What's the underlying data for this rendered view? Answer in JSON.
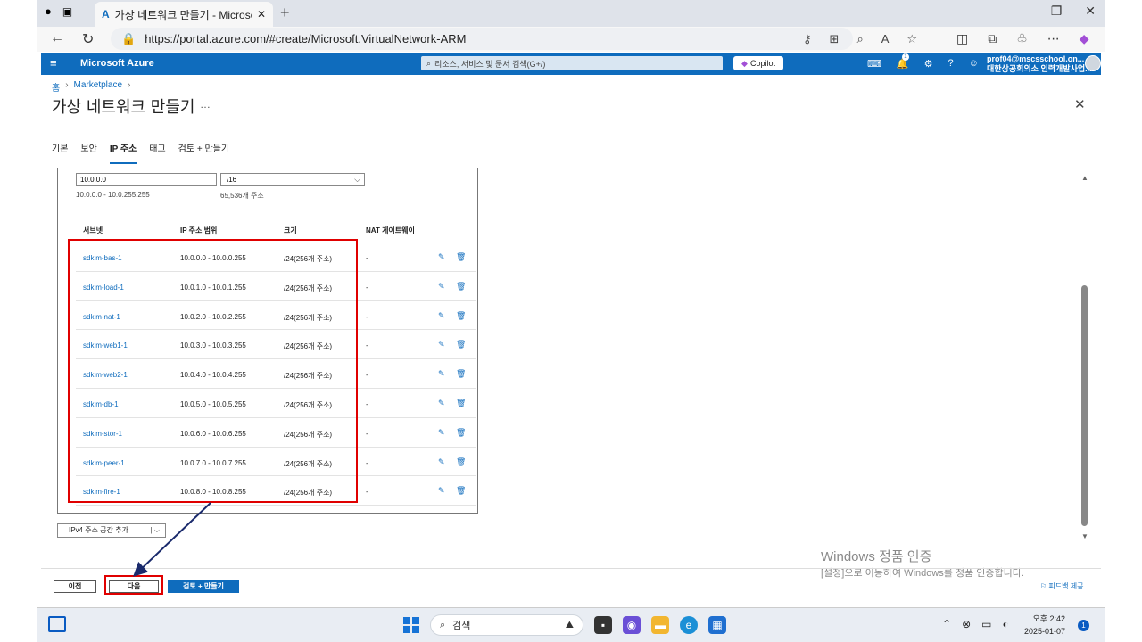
{
  "browser": {
    "tab_title": "가상 네트워크 만들기 - Microsoft",
    "new_tab": "+",
    "url": "https://portal.azure.com/#create/Microsoft.VirtualNetwork-ARM"
  },
  "azure": {
    "brand": "Microsoft Azure",
    "search_placeholder": "리소스, 서비스 및 문서 검색(G+/)",
    "copilot": "Copilot",
    "notification_count": "1",
    "user_email": "prof04@mscsschool.on...",
    "user_org": "대한상공회의소 인력개발사업..."
  },
  "page": {
    "breadcrumb": [
      "홈",
      "Marketplace"
    ],
    "title": "가상 네트워크 만들기",
    "more": "…",
    "close": "✕",
    "tabs": [
      "기본",
      "보안",
      "IP 주소",
      "태그",
      "검토 + 만들기"
    ],
    "active_tab": "IP 주소"
  },
  "address_space": {
    "ip": "10.0.0.0",
    "prefix": "/16",
    "range": "10.0.0.0 - 10.0.255.255",
    "count": "65,536개 주소"
  },
  "subnet_table": {
    "headers": [
      "서브넷",
      "IP 주소 범위",
      "크기",
      "NAT 게이트웨이"
    ],
    "rows": [
      {
        "name": "sdkim-bas-1",
        "range": "10.0.0.0 - 10.0.0.255",
        "size": "/24(256개 주소)",
        "nat": "-"
      },
      {
        "name": "sdkim-load-1",
        "range": "10.0.1.0 - 10.0.1.255",
        "size": "/24(256개 주소)",
        "nat": "-"
      },
      {
        "name": "sdkim-nat-1",
        "range": "10.0.2.0 - 10.0.2.255",
        "size": "/24(256개 주소)",
        "nat": "-"
      },
      {
        "name": "sdkim-web1-1",
        "range": "10.0.3.0 - 10.0.3.255",
        "size": "/24(256개 주소)",
        "nat": "-"
      },
      {
        "name": "sdkim-web2-1",
        "range": "10.0.4.0 - 10.0.4.255",
        "size": "/24(256개 주소)",
        "nat": "-"
      },
      {
        "name": "sdkim-db-1",
        "range": "10.0.5.0 - 10.0.5.255",
        "size": "/24(256개 주소)",
        "nat": "-"
      },
      {
        "name": "sdkim-stor-1",
        "range": "10.0.6.0 - 10.0.6.255",
        "size": "/24(256개 주소)",
        "nat": "-"
      },
      {
        "name": "sdkim-peer-1",
        "range": "10.0.7.0 - 10.0.7.255",
        "size": "/24(256개 주소)",
        "nat": "-"
      },
      {
        "name": "sdkim-fire-1",
        "range": "10.0.8.0 - 10.0.8.255",
        "size": "/24(256개 주소)",
        "nat": "-"
      }
    ]
  },
  "add_space_button": "IPv4 주소 공간 추가",
  "footer": {
    "prev": "이전",
    "next": "다음",
    "review_create": "검토 + 만들기"
  },
  "watermark": {
    "line1": "Windows 정품 인증",
    "line2": "[설정]으로 이동하여 Windows를 정품 인증합니다."
  },
  "feedback": "피드백 제공",
  "taskbar": {
    "search": "검색",
    "time": "오후 2:42",
    "date": "2025-01-07",
    "notifications": "1"
  },
  "colors": {
    "azure_blue": "#0f6cbd",
    "highlight_red": "#e00000",
    "arrow_navy": "#1a2a6c"
  }
}
